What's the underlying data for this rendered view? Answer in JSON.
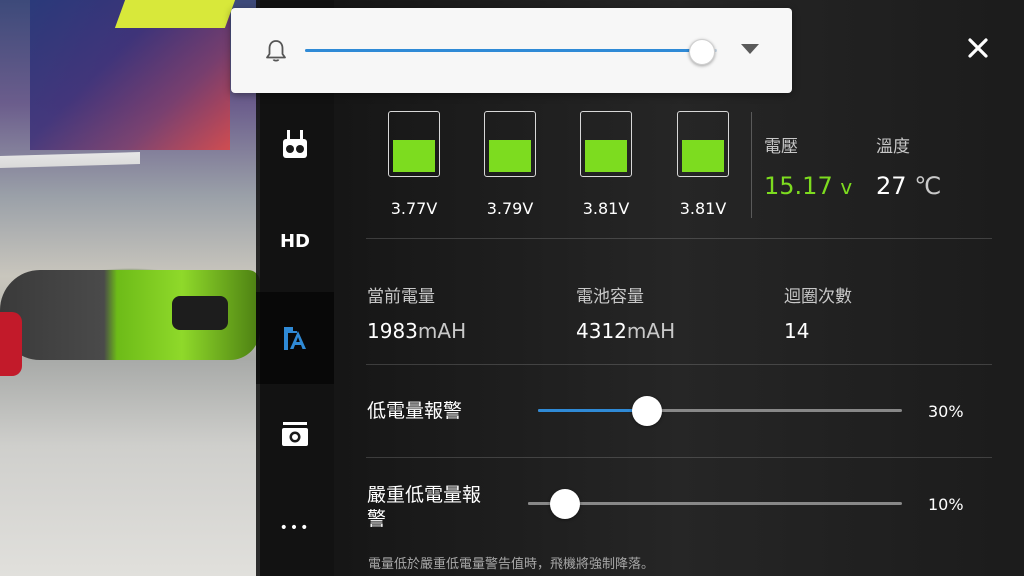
{
  "volume": {
    "level": 0.96
  },
  "rail": {
    "items": [
      {
        "name": "controller-icon"
      },
      {
        "name": "hd-icon",
        "label": "HD"
      },
      {
        "name": "battery-settings-icon"
      },
      {
        "name": "camera-icon"
      },
      {
        "name": "more-icon",
        "label": "•••"
      }
    ],
    "active_index": 2
  },
  "battery": {
    "cells": [
      {
        "voltage": "3.77V",
        "level": 0.58
      },
      {
        "voltage": "3.79V",
        "level": 0.58
      },
      {
        "voltage": "3.81V",
        "level": 0.58
      },
      {
        "voltage": "3.81V",
        "level": 0.58
      }
    ],
    "voltage_label": "電壓",
    "voltage_value": "15.17",
    "voltage_unit": "v",
    "temp_label": "溫度",
    "temp_value": "27",
    "temp_unit": "℃",
    "current_label": "當前電量",
    "current_value": "1983",
    "current_unit": "mAH",
    "capacity_label": "電池容量",
    "capacity_value": "4312",
    "capacity_unit": "mAH",
    "cycles_label": "迴圈次數",
    "cycles_value": "14"
  },
  "alerts": {
    "low_label": "低電量報警",
    "low_percent": "30%",
    "low_level": 0.3,
    "critical_label_line1": "嚴重低電量報",
    "critical_label_line2": "警",
    "critical_percent": "10%",
    "critical_level": 0.1,
    "note": "電量低於嚴重低電量警告值時，飛機將強制降落。"
  },
  "colors": {
    "accent": "#2f8ad6",
    "battery_green": "#7ddc1f"
  }
}
